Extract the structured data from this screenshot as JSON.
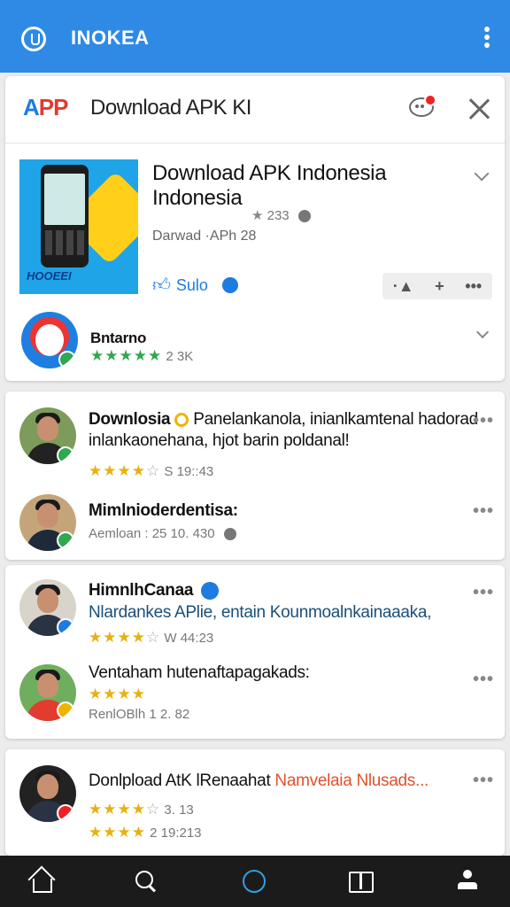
{
  "app": {
    "title": "INOKEA"
  },
  "ad_header": {
    "badge": [
      "A",
      "P",
      "P"
    ],
    "title": "Download APK KI"
  },
  "ad": {
    "title": "Download APK Indonesia Indonesia",
    "rating": "233",
    "subtitle": "Darwad ·APh 28",
    "like_label": "Sulo",
    "thumb_label": "HOOEEI",
    "actions": [
      "·▲",
      "+",
      "•••"
    ]
  },
  "featured": {
    "name": "Bntarno",
    "rating_text": "2 3K",
    "stars": "★★★★★"
  },
  "posts": [
    {
      "name": "Downlosia",
      "text": "Panelankanola, inianlkamtenal hadorad inlankaonehana, hjot barin poldanal!",
      "stars": "★★★★",
      "half": "☆",
      "meta": "S 19::43"
    },
    {
      "name": "Mimlnioderdentisa:",
      "text": "",
      "meta": "Aemloan : 25 10. 430"
    },
    {
      "name": "HimnlhCanaa",
      "text": "Nlardankes APlie, entain Kounmoalnkainaaaka,",
      "stars": "★★★★",
      "half": "☆",
      "meta": "W 44:23"
    },
    {
      "name": "Ventaham hutenaftapagakads:",
      "text": "",
      "stars": "★★★★",
      "meta": "RenlOBlh 1 2. 82"
    },
    {
      "name": "Donlpload AtK lRenaahat",
      "highlight": "Namvelaia Nlusads...",
      "stars": "★★★★",
      "half": "☆",
      "meta": "3. 13",
      "stars2": "★★★★",
      "meta2": "2 19:213"
    }
  ],
  "colors": {
    "topbar": "#2f8ae6",
    "accent": "#1e7be0",
    "star": "#e9b010",
    "highlight": "#e0522a"
  }
}
